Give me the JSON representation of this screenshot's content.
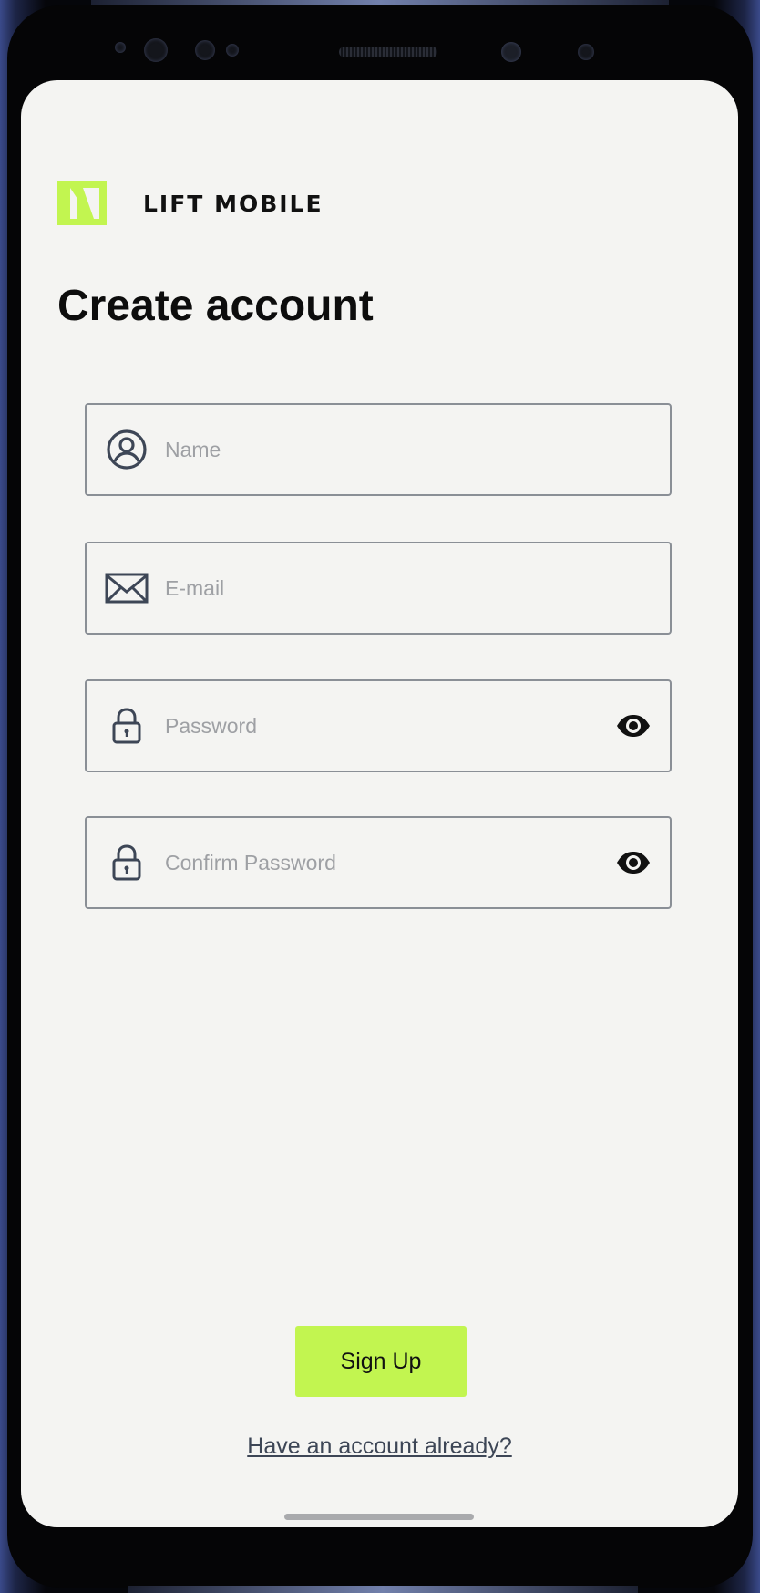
{
  "app": {
    "brand_name": "LIFT MOBILE"
  },
  "page": {
    "title": "Create account"
  },
  "form": {
    "name_placeholder": "Name",
    "email_placeholder": "E-mail",
    "password_placeholder": "Password",
    "confirm_password_placeholder": "Confirm Password"
  },
  "actions": {
    "signup_label": "Sign Up",
    "signin_link": "Have an account already?"
  },
  "icons": {
    "logo": "lift-mobile-logo",
    "name": "user-circle-icon",
    "email": "envelope-icon",
    "password": "lock-icon",
    "password_toggle": "eye-icon",
    "confirm_password": "lock-icon",
    "confirm_password_toggle": "eye-icon"
  },
  "colors": {
    "accent": "#c2f550",
    "screen_background": "#f4f4f2",
    "title_text": "#0d0d0d",
    "placeholder_text": "#9ea0a4",
    "field_border": "#8a8f96",
    "link_text": "#3d4656"
  }
}
